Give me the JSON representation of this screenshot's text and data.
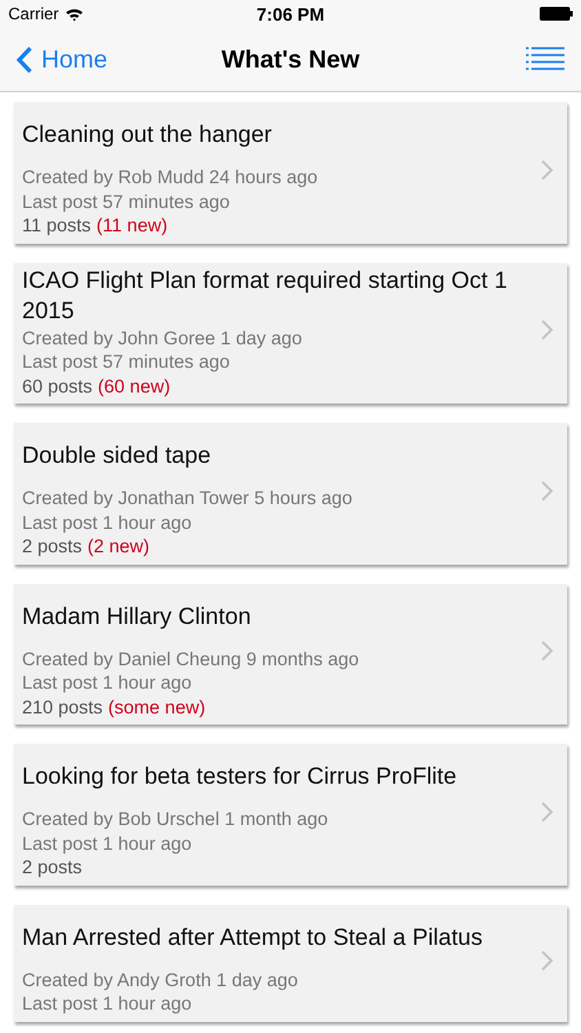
{
  "status_bar": {
    "carrier": "Carrier",
    "time": "7:06 PM"
  },
  "nav_bar": {
    "back_label": "Home",
    "title": "What's New"
  },
  "topics": [
    {
      "title": "Cleaning out the hanger",
      "created": "Created by Rob Mudd 24 hours ago",
      "last_post": "Last post 57 minutes ago",
      "posts": "11 posts",
      "new": "(11 new)"
    },
    {
      "title": "ICAO Flight Plan format required starting Oct 1 2015",
      "created": "Created by John Goree 1 day ago",
      "last_post": "Last post 57 minutes ago",
      "posts": "60 posts",
      "new": "(60 new)"
    },
    {
      "title": "Double sided tape",
      "created": "Created by Jonathan Tower 5 hours ago",
      "last_post": "Last post 1 hour ago",
      "posts": "2 posts",
      "new": "(2 new)"
    },
    {
      "title": "Madam Hillary Clinton",
      "created": "Created by Daniel Cheung 9 months ago",
      "last_post": "Last post 1 hour ago",
      "posts": "210 posts",
      "new": "(some new)"
    },
    {
      "title": "Looking for beta testers for Cirrus ProFlite",
      "created": "Created by Bob Urschel 1 month ago",
      "last_post": "Last post 1 hour ago",
      "posts": "2 posts"
    },
    {
      "title": "Man Arrested after Attempt to Steal a Pilatus",
      "created": "Created by Andy Groth 1 day ago",
      "last_post": "Last post 1 hour ago"
    }
  ]
}
